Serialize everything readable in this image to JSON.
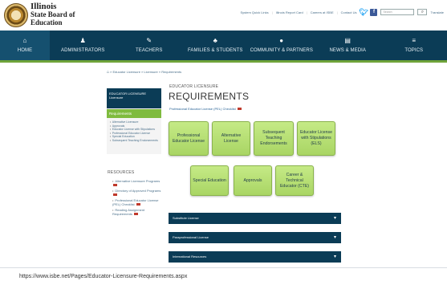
{
  "header": {
    "logo_line1": "Illinois",
    "logo_line2": "State Board of",
    "logo_line3": "Education",
    "util_links": [
      "System Quick Links",
      "Illinois Report Card",
      "Careers at ISBE",
      "Contact Us"
    ],
    "search_placeholder": "Search",
    "translate": "Translate"
  },
  "nav": {
    "items": [
      {
        "label": "HOME",
        "icon": "home-icon",
        "glyph": "⌂"
      },
      {
        "label": "ADMINISTRATORS",
        "icon": "administrator-icon",
        "glyph": "♟"
      },
      {
        "label": "TEACHERS",
        "icon": "teacher-icon",
        "glyph": "✎"
      },
      {
        "label": "FAMILIES & STUDENTS",
        "icon": "family-icon",
        "glyph": "♣"
      },
      {
        "label": "COMMUNITY & PARTNERS",
        "icon": "community-icon",
        "glyph": "●"
      },
      {
        "label": "NEWS & MEDIA",
        "icon": "news-icon",
        "glyph": "▤"
      },
      {
        "label": "TOPICS",
        "icon": "topics-icon",
        "glyph": "≡"
      }
    ],
    "active": "HOME"
  },
  "breadcrumb": "» Educator Licensure » Licensure » Requirements",
  "sidebar": {
    "header_line1": "EDUCATOR LICENSURE",
    "header_line2": "Licensure",
    "current": "Requirements",
    "items": [
      "Alternative Licensure",
      "Approvals",
      "Educator License with Stipulations",
      "Professional Educator License",
      "Special Education",
      "Subsequent Teaching Endorsements"
    ]
  },
  "resources": {
    "title": "RESOURCES",
    "items": [
      "Alternative Licensure Programs",
      "Directory of Approved Programs",
      "Professional Educator License (PEL) Checklist",
      "Reading Assignment Requirements"
    ]
  },
  "main": {
    "overline": "EDUCATOR LICENSURE",
    "title": "REQUIREMENTS",
    "link": "Professional Educator License (PEL) Checklist",
    "tiles": [
      "Professional Educator License",
      "Alternative License",
      "Subsequent Teaching Endorsements",
      "Educator License with Stipulations (ELS)",
      "Special Education",
      "Approvals",
      "Career & Technical Educator (CTE)"
    ],
    "accordions": [
      "Substitute License",
      "Paraprofessional License",
      "International Resources"
    ]
  },
  "url": "https://www.isbe.net/Pages/Educator-Licensure-Requirements.aspx",
  "colors": {
    "nav_bg": "#0b3c56",
    "accent_green": "#7fbb3e",
    "tile_green": "#b8e074"
  }
}
